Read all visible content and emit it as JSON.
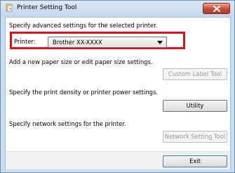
{
  "window": {
    "title": "Printer Setting Tool",
    "close_symbol": "×"
  },
  "header": {
    "description": "Specify advanced settings for the selected printer."
  },
  "printer": {
    "label": "Printer:",
    "selected": "Brother XX-XXXX",
    "highlight_color": "#e0101e"
  },
  "sections": [
    {
      "description": "Add a new paper size or edit paper size settings.",
      "button_label": "Custom Label Tool",
      "enabled": false
    },
    {
      "description": "Specify the print density or printer power settings.",
      "button_label": "Utility",
      "enabled": true
    },
    {
      "description": "Specify network settings for the printer.",
      "button_label": "Network Setting Tool",
      "enabled": false
    }
  ],
  "footer": {
    "exit_label": "Exit"
  },
  "icons": {
    "app": "printer-setting-icon",
    "close": "close-icon",
    "dropdown": "chevron-down-icon"
  }
}
